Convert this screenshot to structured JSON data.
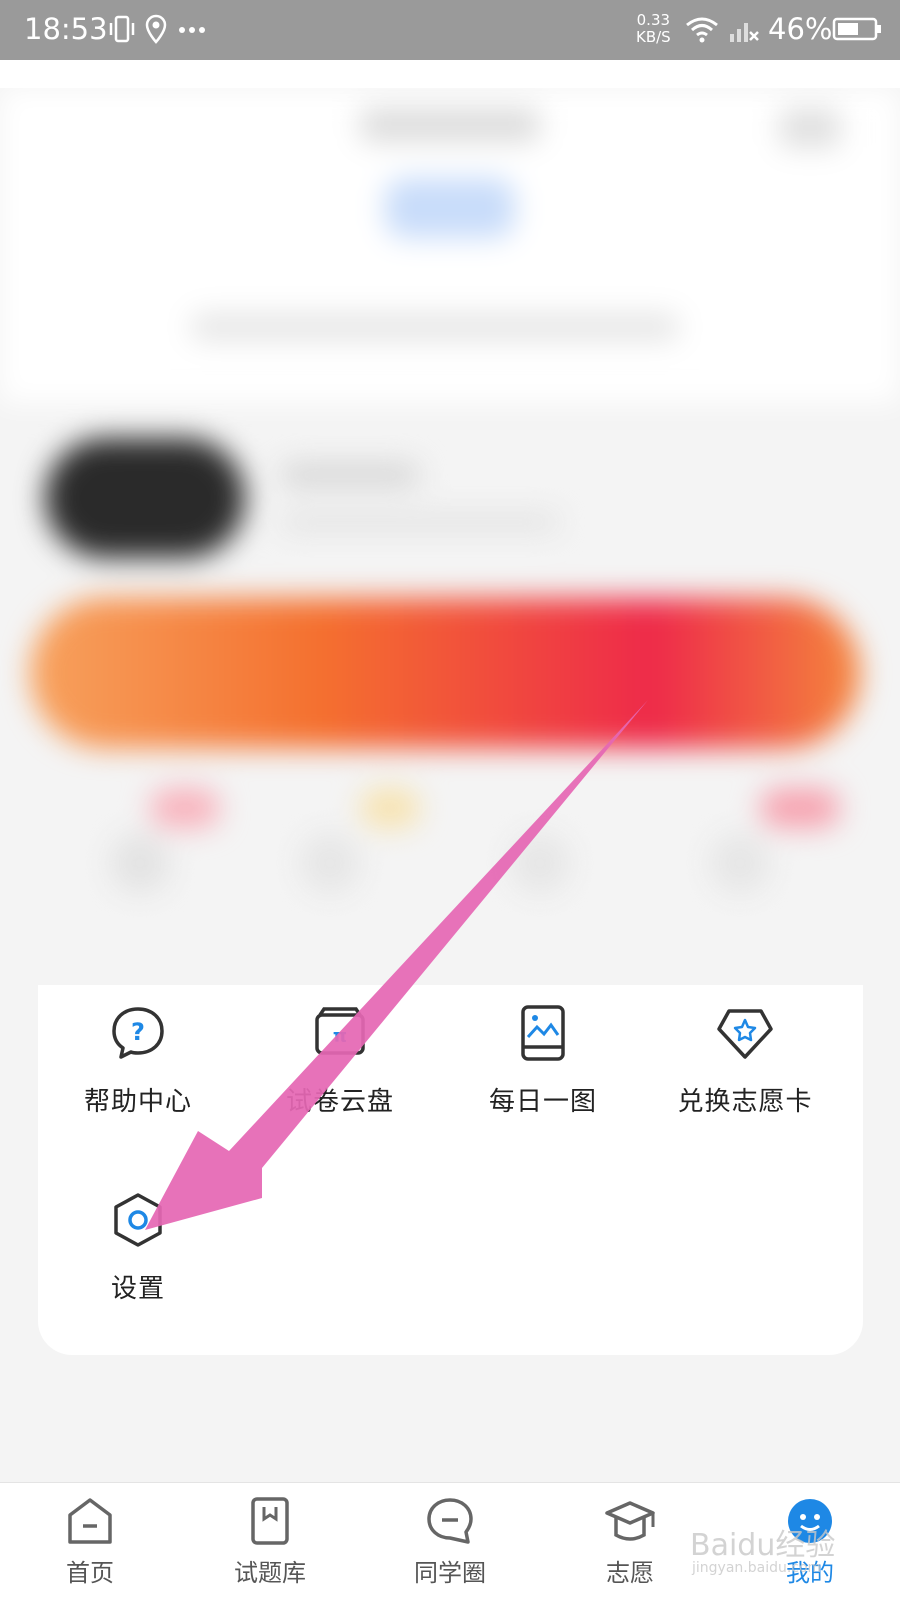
{
  "status_bar": {
    "time": "18:53",
    "speed_value": "0.33",
    "speed_unit": "KB/S",
    "battery": "46%"
  },
  "menu": {
    "items": [
      {
        "label": "帮助中心",
        "icon": "help-icon"
      },
      {
        "label": "试卷云盘",
        "icon": "cloud-folder-icon"
      },
      {
        "label": "每日一图",
        "icon": "daily-image-icon"
      },
      {
        "label": "兑换志愿卡",
        "icon": "exchange-card-icon"
      },
      {
        "label": "设置",
        "icon": "settings-icon"
      }
    ]
  },
  "tab_bar": {
    "tabs": [
      {
        "label": "首页",
        "icon": "home-icon"
      },
      {
        "label": "试题库",
        "icon": "question-bank-icon"
      },
      {
        "label": "同学圈",
        "icon": "chat-icon"
      },
      {
        "label": "志愿",
        "icon": "graduation-cap-icon"
      },
      {
        "label": "我的",
        "icon": "profile-icon",
        "active": true
      }
    ]
  },
  "watermark": {
    "text": "Baidu经验",
    "sub": "jingyan.baidu.com"
  },
  "colors": {
    "accent": "#1e88e5",
    "arrow": "#e567b4"
  }
}
